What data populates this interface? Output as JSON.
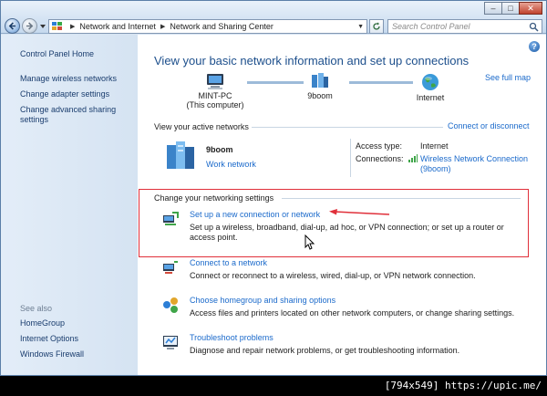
{
  "address": {
    "crumbs": [
      "Network and Internet",
      "Network and Sharing Center"
    ],
    "search_placeholder": "Search Control Panel"
  },
  "left": {
    "home": "Control Panel Home",
    "links": [
      "Manage wireless networks",
      "Change adapter settings",
      "Change advanced sharing settings"
    ],
    "see_also": "See also",
    "see_also_links": [
      "HomeGroup",
      "Internet Options",
      "Windows Firewall"
    ]
  },
  "main": {
    "heading": "View your basic network information and set up connections",
    "see_full_map": "See full map",
    "map": {
      "computer": "MINT-PC",
      "computer_sub": "(This computer)",
      "network": "9boom",
      "internet": "Internet"
    },
    "active_header": "View your active networks",
    "connect_disconnect": "Connect or disconnect",
    "active": {
      "name": "9boom",
      "type": "Work network",
      "access_label": "Access type:",
      "access_value": "Internet",
      "conn_label": "Connections:",
      "conn_value_1": "Wireless Network Connection",
      "conn_value_2": "(9boom)"
    },
    "change_header": "Change your networking settings",
    "tasks": [
      {
        "title": "Set up a new connection or network",
        "desc": "Set up a wireless, broadband, dial-up, ad hoc, or VPN connection; or set up a router or access point."
      },
      {
        "title": "Connect to a network",
        "desc": "Connect or reconnect to a wireless, wired, dial-up, or VPN network connection."
      },
      {
        "title": "Choose homegroup and sharing options",
        "desc": "Access files and printers located on other network computers, or change sharing settings."
      },
      {
        "title": "Troubleshoot problems",
        "desc": "Diagnose and repair network problems, or get troubleshooting information."
      }
    ]
  },
  "footer": "[794x549] https://upic.me/",
  "colors": {
    "link": "#1b6acb",
    "heading": "#1d4f8c",
    "highlight": "#e0303a"
  }
}
